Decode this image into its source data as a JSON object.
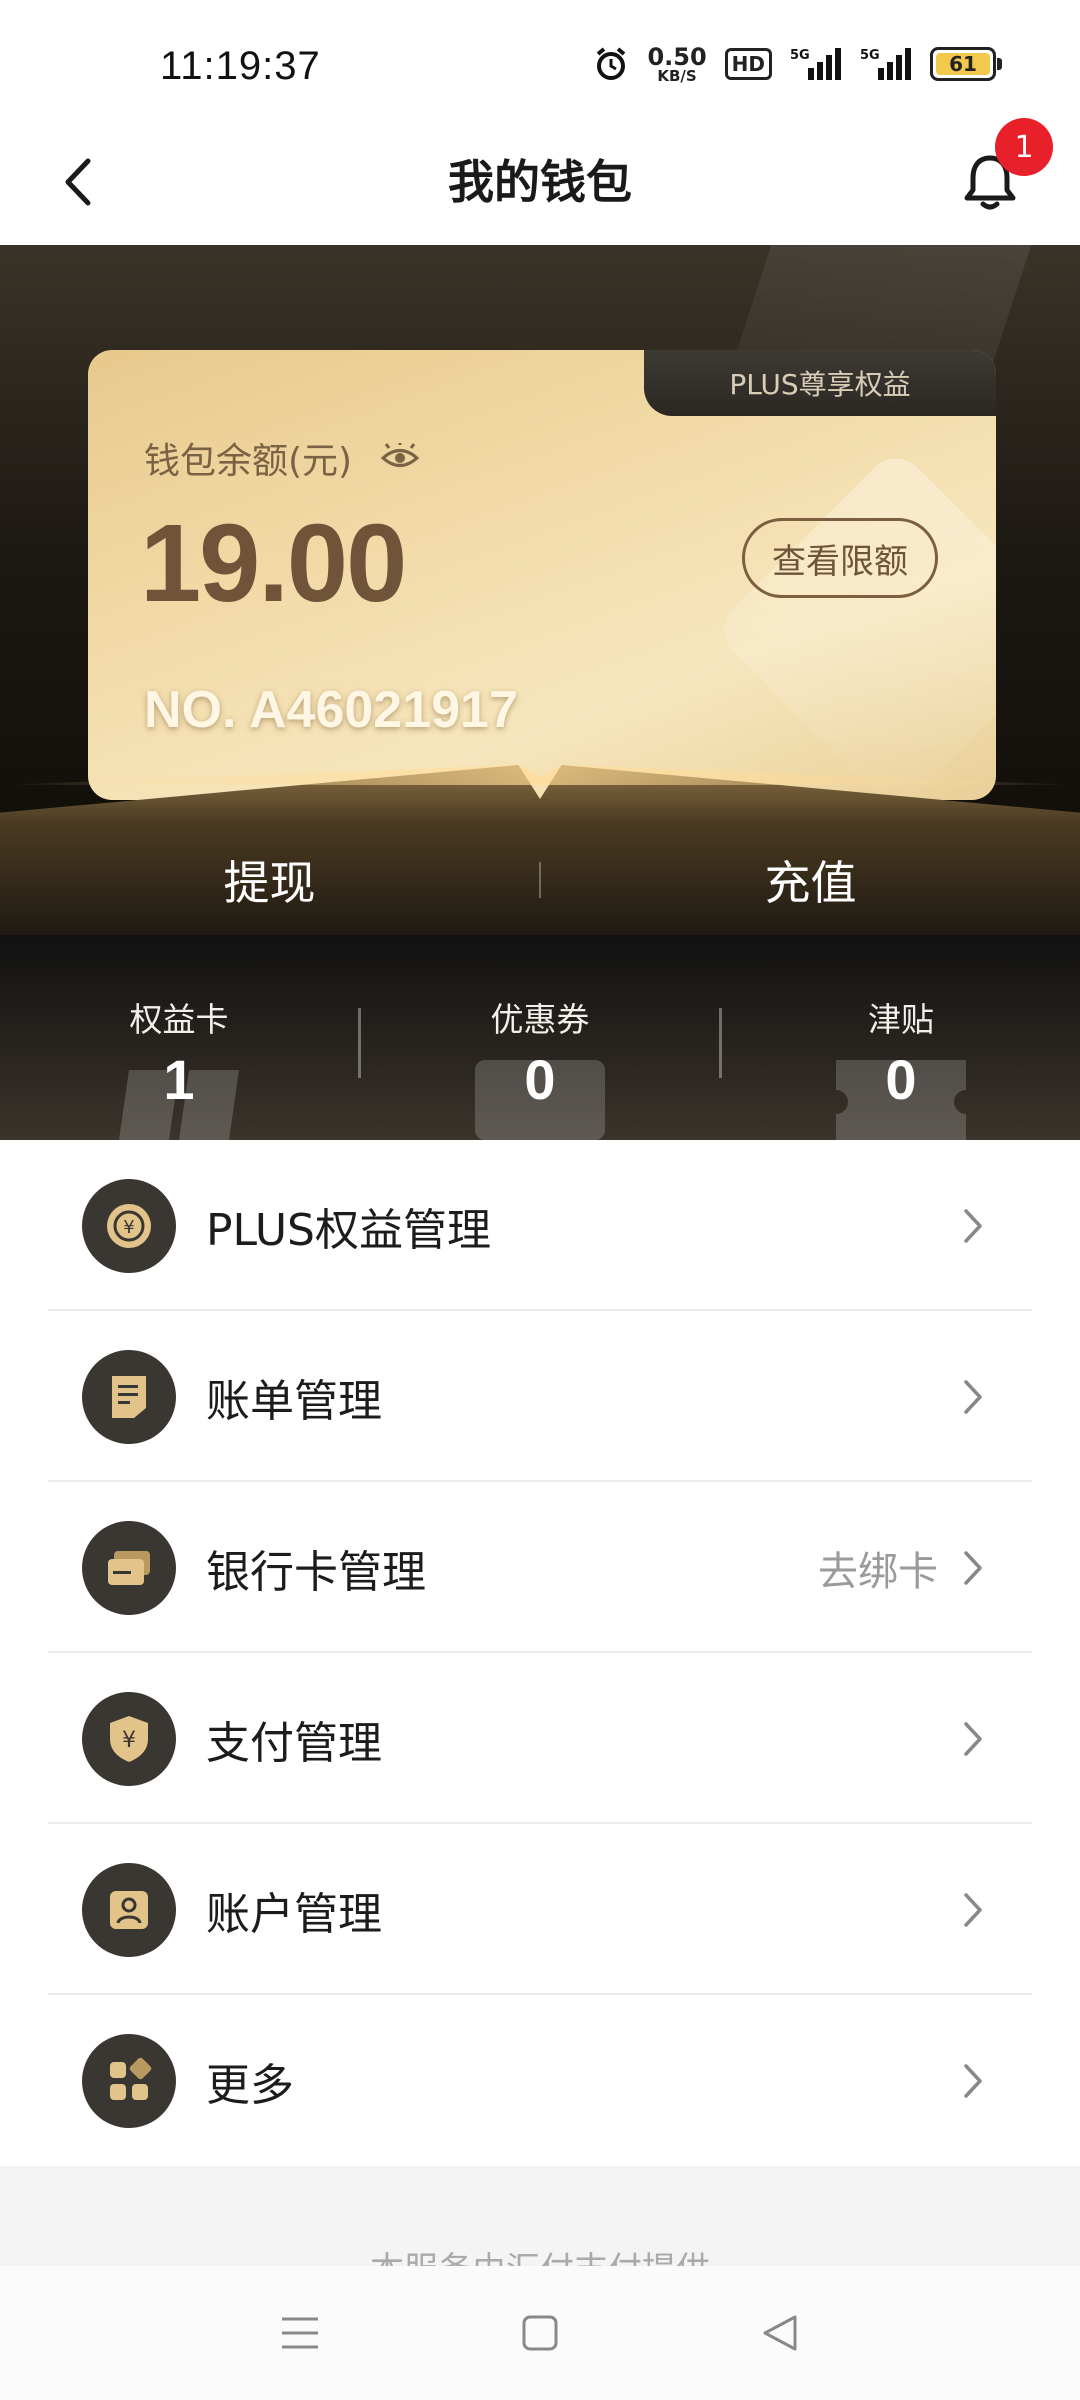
{
  "status_bar": {
    "time": "11:19:37",
    "net_speed_value": "0.50",
    "net_speed_unit": "KB/S",
    "hd_label": "HD",
    "battery_level": "61",
    "icons": [
      "alarm-icon",
      "hd-icon",
      "signal-5g-icon",
      "signal-5g-icon",
      "battery-icon"
    ]
  },
  "header": {
    "title": "我的钱包",
    "notification_count": "1"
  },
  "wallet_card": {
    "tab_label": "PLUS尊享权益",
    "balance_label": "钱包余额(元)",
    "balance_amount": "19.00",
    "limit_button": "查看限额",
    "card_number": "NO. A46021917"
  },
  "actions": {
    "withdraw": "提现",
    "recharge": "充值"
  },
  "stats": [
    {
      "label": "权益卡",
      "value": "1"
    },
    {
      "label": "优惠券",
      "value": "0"
    },
    {
      "label": "津贴",
      "value": "0"
    }
  ],
  "menu": [
    {
      "label": "PLUS权益管理",
      "icon": "plus-coin-icon",
      "extra": ""
    },
    {
      "label": "账单管理",
      "icon": "bill-icon",
      "extra": ""
    },
    {
      "label": "银行卡管理",
      "icon": "bank-card-icon",
      "extra": "去绑卡"
    },
    {
      "label": "支付管理",
      "icon": "payment-shield-icon",
      "extra": ""
    },
    {
      "label": "账户管理",
      "icon": "account-icon",
      "extra": ""
    },
    {
      "label": "更多",
      "icon": "more-grid-icon",
      "extra": ""
    }
  ],
  "footer_note": "本服务由汇付支付提供",
  "colors": {
    "accent_gold": "#e7c98d",
    "dark": "#1c1812",
    "badge_red": "#e8202a"
  }
}
